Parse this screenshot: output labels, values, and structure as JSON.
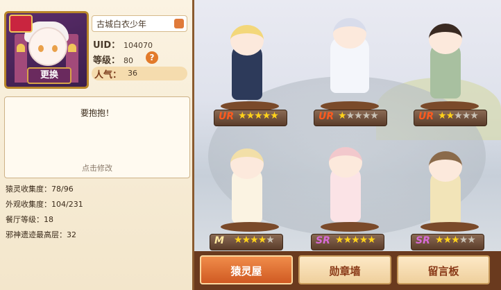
{
  "profile": {
    "change_label": "更换",
    "name": "古城白衣少年",
    "uid_label": "UID：",
    "uid_value": "104070",
    "level_label": "等级：",
    "level_value": "80",
    "help_glyph": "?",
    "popularity_label": "人气：",
    "popularity_value": "36"
  },
  "signature": {
    "text": "要抱抱！",
    "hint": "点击修改"
  },
  "stats": [
    {
      "label": "猿灵收集度：",
      "value": "78/96"
    },
    {
      "label": "外观收集度：",
      "value": "104/231"
    },
    {
      "label": "餐厅等级：",
      "value": "18"
    },
    {
      "label": "邪神遗迹最高层：",
      "value": "32"
    }
  ],
  "characters": [
    {
      "grade": "UR",
      "stars": 5,
      "max_stars": 5,
      "grade_color": "#ff5a1e"
    },
    {
      "grade": "UR",
      "stars": 1,
      "max_stars": 5,
      "grade_color": "#ff5a1e"
    },
    {
      "grade": "UR",
      "stars": 2,
      "max_stars": 5,
      "grade_color": "#ff5a1e"
    },
    {
      "grade": "M",
      "stars": 4,
      "max_stars": 5,
      "grade_color": "#ffe9a0"
    },
    {
      "grade": "SR",
      "stars": 5,
      "max_stars": 5,
      "grade_color": "#d86ad8"
    },
    {
      "grade": "SR",
      "stars": 3,
      "max_stars": 5,
      "grade_color": "#d86ad8"
    }
  ],
  "tabs": [
    {
      "label": "猿灵屋",
      "active": true
    },
    {
      "label": "勋章墙",
      "active": false
    },
    {
      "label": "留言板",
      "active": false
    }
  ]
}
